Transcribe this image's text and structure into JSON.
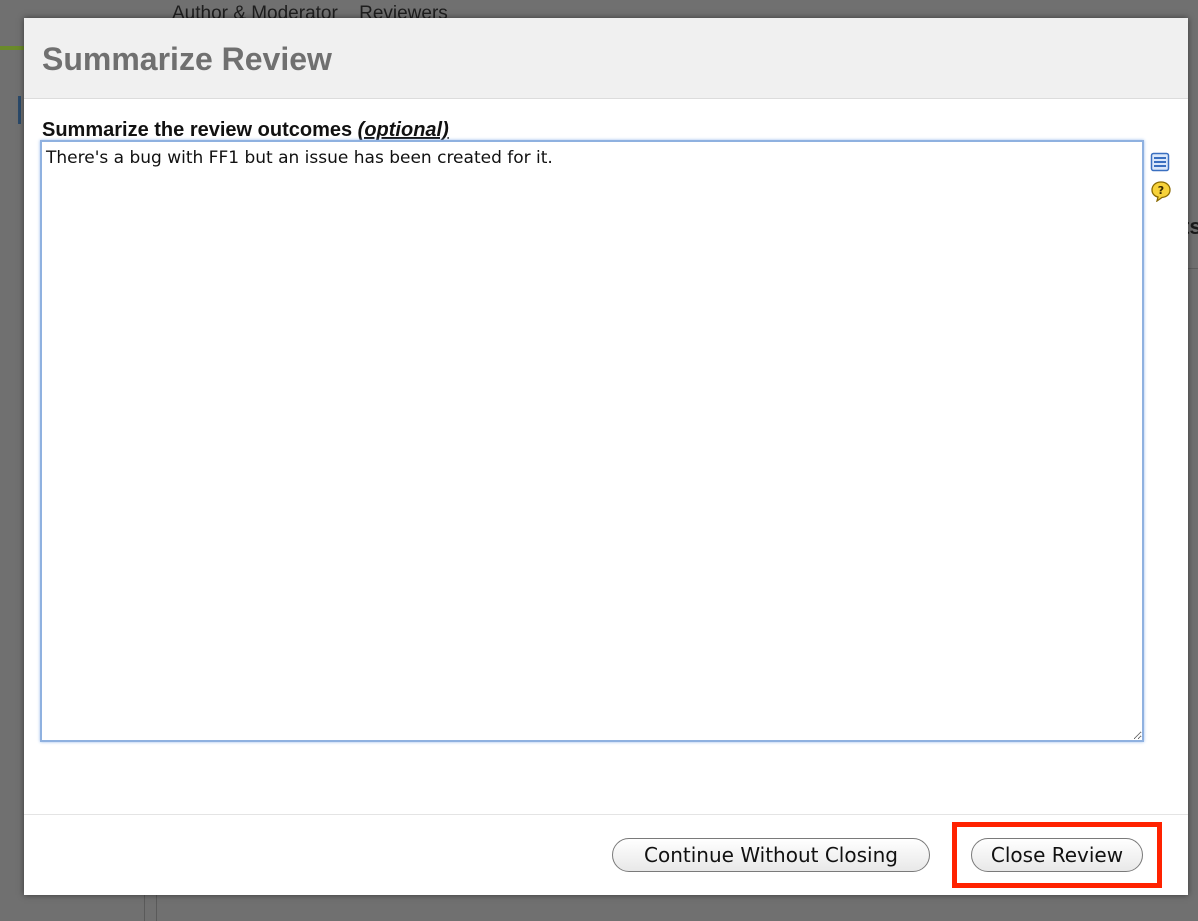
{
  "background": {
    "tabs": [
      "Author & Moderator",
      "Reviewers"
    ],
    "right_fragment": "ts"
  },
  "dialog": {
    "title": "Summarize Review",
    "field_label": "Summarize the review outcomes",
    "field_label_optional": "(optional)",
    "summary_text": "There's a bug with FF1 but an issue has been created for it.",
    "side_icons": [
      "formatting-icon",
      "help-icon"
    ],
    "buttons": {
      "continue_label": "Continue Without Closing",
      "close_label": "Close Review"
    },
    "highlight_color": "#ff2200"
  }
}
